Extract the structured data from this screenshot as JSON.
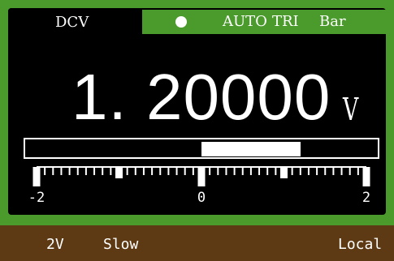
{
  "mode": "DCV",
  "status": {
    "indicator_icon": "status-dot-icon",
    "auto": "AUTO",
    "trigger": "TRI",
    "view": "Bar"
  },
  "reading": {
    "value": "1. 20000",
    "unit": "V"
  },
  "bar_graph": {
    "min": -2,
    "max": 2,
    "value": 1.2,
    "tick_labels": [
      "-2",
      "0",
      "2"
    ]
  },
  "footer": {
    "range": "2V",
    "speed": "Slow",
    "control": "Local"
  },
  "colors": {
    "frame": "#4a9a2c",
    "screen": "#000000",
    "footer": "#5e3a14",
    "foreground": "#ffffff"
  }
}
